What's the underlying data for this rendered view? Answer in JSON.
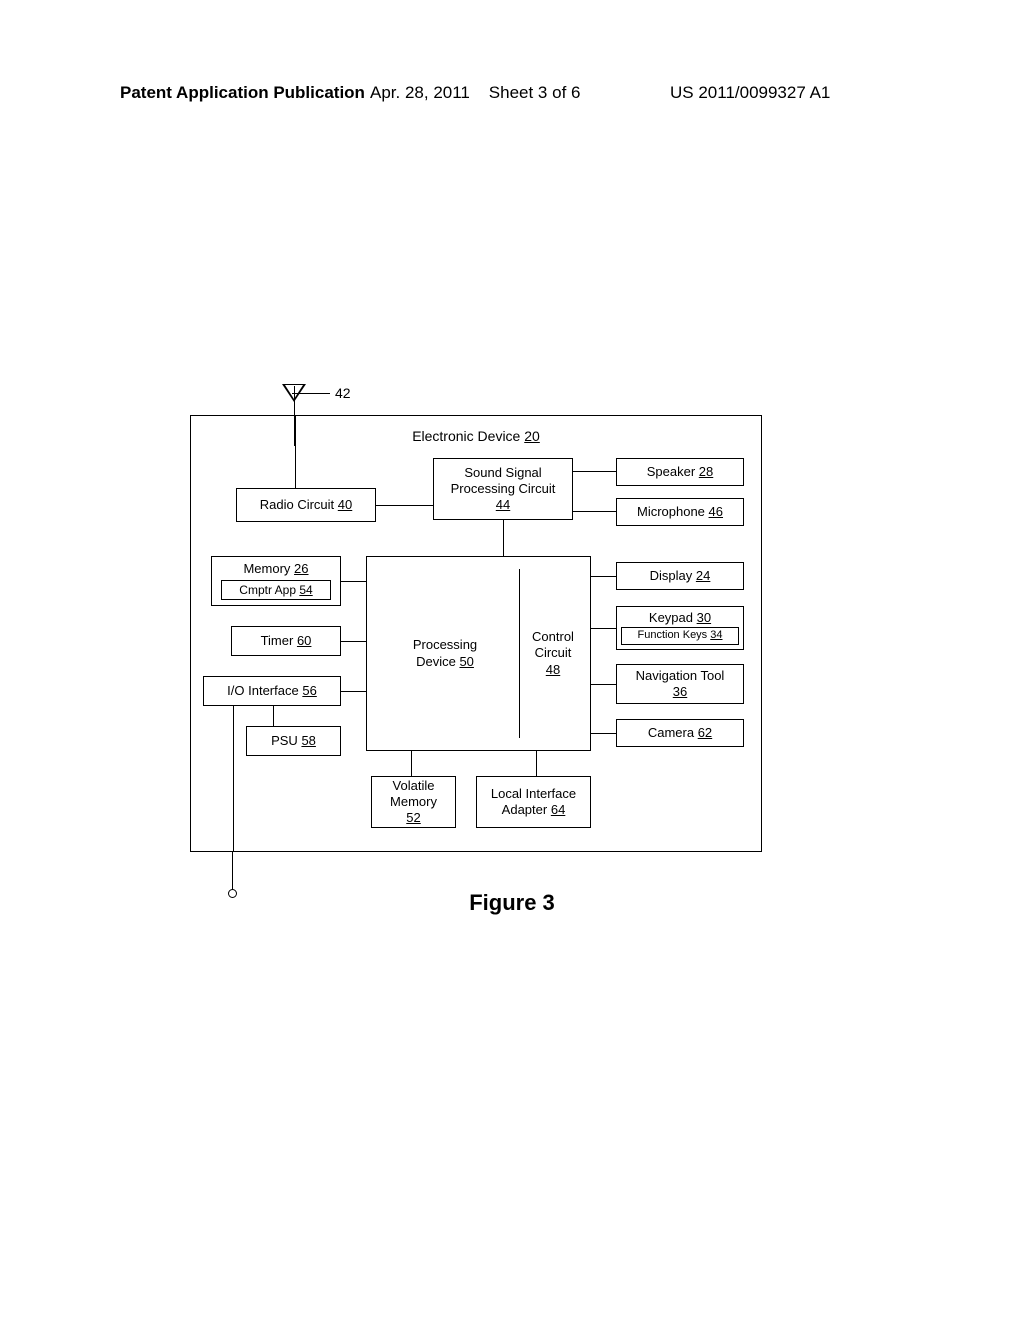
{
  "header": {
    "left": "Patent Application Publication",
    "mid_date": "Apr. 28, 2011",
    "mid_sheet": "Sheet 3 of 6",
    "right": "US 2011/0099327 A1"
  },
  "antenna": {
    "ref": "42"
  },
  "container": {
    "label": "Electronic Device",
    "ref": "20"
  },
  "blocks": {
    "radio": {
      "label": "Radio Circuit",
      "ref": "40"
    },
    "sound": {
      "label1": "Sound Signal",
      "label2": "Processing Circuit",
      "ref": "44"
    },
    "speaker": {
      "label": "Speaker",
      "ref": "28"
    },
    "microphone": {
      "label": "Microphone",
      "ref": "46"
    },
    "memory": {
      "label": "Memory",
      "ref": "26"
    },
    "cmptr": {
      "label": "Cmptr App",
      "ref": "54"
    },
    "display": {
      "label": "Display",
      "ref": "24"
    },
    "timer": {
      "label": "Timer",
      "ref": "60"
    },
    "processing": {
      "label1": "Processing",
      "label2": "Device",
      "ref": "50"
    },
    "control": {
      "label1": "Control",
      "label2": "Circuit",
      "ref": "48"
    },
    "keypad": {
      "label": "Keypad",
      "ref": "30"
    },
    "funckeys": {
      "label": "Function Keys",
      "ref": "34"
    },
    "io": {
      "label": "I/O Interface",
      "ref": "56"
    },
    "nav": {
      "label1": "Navigation Tool",
      "ref": "36"
    },
    "psu": {
      "label": "PSU",
      "ref": "58"
    },
    "camera": {
      "label": "Camera",
      "ref": "62"
    },
    "volmem": {
      "label1": "Volatile",
      "label2": "Memory",
      "ref": "52"
    },
    "localif": {
      "label1": "Local Interface",
      "label2": "Adapter",
      "ref": "64"
    }
  },
  "figure": "Figure 3"
}
